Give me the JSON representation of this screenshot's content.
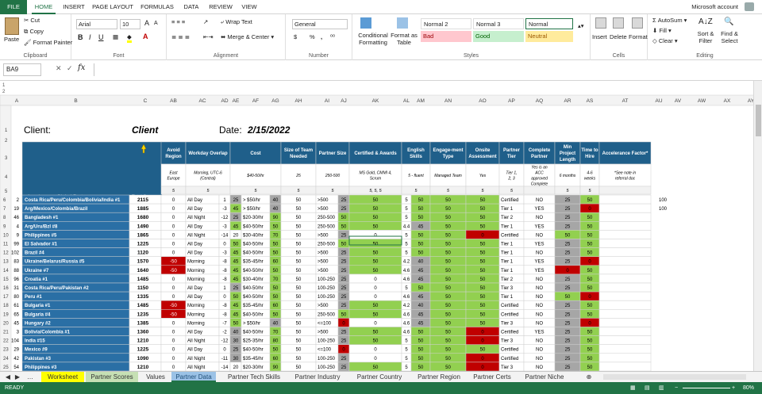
{
  "ribbon_tabs": [
    "FILE",
    "HOME",
    "INSERT",
    "PAGE LAYOUT",
    "FORMULAS",
    "DATA",
    "REVIEW",
    "VIEW"
  ],
  "account": "Microsoft account",
  "clipboard": {
    "paste": "Paste",
    "cut": "Cut",
    "copy": "Copy",
    "format_painter": "Format Painter",
    "label": "Clipboard"
  },
  "font": {
    "name": "Arial",
    "size": "10",
    "label": "Font",
    "grow": "A",
    "shrink": "A",
    "bold": "B",
    "italic": "I",
    "underline": "U"
  },
  "alignment": {
    "wrap": "Wrap Text",
    "merge": "Merge & Center",
    "label": "Alignment"
  },
  "number": {
    "format": "General",
    "currency": "$",
    "percent": "%",
    "comma": ",",
    "label": "Number"
  },
  "styles": {
    "conditional": "Conditional Formatting",
    "format_as_table": "Format as Table",
    "label": "Styles",
    "cells": [
      {
        "name": "Normal 2",
        "bg": "#ffffff",
        "fg": "#000000"
      },
      {
        "name": "Normal 3",
        "bg": "#ffffff",
        "fg": "#000000"
      },
      {
        "name": "Normal",
        "bg": "#ffffff",
        "fg": "#000000"
      },
      {
        "name": "Bad",
        "bg": "#ffc7ce",
        "fg": "#9c0006"
      },
      {
        "name": "Good",
        "bg": "#c6efce",
        "fg": "#006100"
      },
      {
        "name": "Neutral",
        "bg": "#ffeb9c",
        "fg": "#9c5700"
      }
    ]
  },
  "cells_group": {
    "insert": "Insert",
    "delete": "Delete",
    "format": "Format",
    "label": "Cells"
  },
  "editing": {
    "autosum": "AutoSum",
    "fill": "Fill",
    "clear": "Clear",
    "sort": "Sort & Filter",
    "find": "Find & Select",
    "label": "Editing"
  },
  "name_box": "BA9",
  "formula_fx": "fx",
  "columns": [
    "A",
    "B",
    "C",
    "AB",
    "AC",
    "AD",
    "AE",
    "AF",
    "AG",
    "AH",
    "AI",
    "AJ",
    "AK",
    "AL",
    "AM",
    "AN",
    "AO",
    "AP",
    "AQ",
    "AR",
    "AS",
    "AT",
    "AU",
    "AV",
    "AW",
    "AX",
    "AY"
  ],
  "client_label": "Client:",
  "client_value": "Client",
  "date_label": "Date:",
  "date_value": "2/15/2022",
  "headers": [
    "Avoid Region",
    "Workday Overlap",
    "Cost",
    "Size of Team Needed",
    "Partner Size",
    "Certified & Awards",
    "English Skills",
    "Engage-ment Type",
    "Onsite Assessment",
    "Partner Tier",
    "Complete Partner",
    "Min Project Length",
    "Time to Hire",
    "Accelerance Factor*"
  ],
  "criteria": [
    "East Europe",
    "Morning, UTC-6 (Central)",
    "$40-50/hr",
    "25",
    "250-500",
    "MS Gold, CMMI 4, Scrum",
    "5 - fluent",
    "Managed Team",
    "Yes",
    "Tier 1, 2, 3",
    "Yes is an ACC approved Complete Partner",
    "6 months",
    "4-6 weeks",
    "*See note in referral doc"
  ],
  "weights": [
    "5",
    "5",
    "5",
    "5",
    "5",
    "5, 5, 5",
    "5",
    "5",
    "5",
    "5",
    "",
    "5",
    "5",
    ""
  ],
  "label_partner": "Accelerance Global Partner",
  "label_total": "Total Score",
  "rows": [
    {
      "n": "6",
      "a": "2",
      "name": "Costa Rica/Peru/Colombia/Bolivia/India #1",
      "total": "2115",
      "ab": "0",
      "ac": "All Day",
      "ad": "1",
      "ae": "25",
      "af": "> $50/hr",
      "ag": "40",
      "ah": "50",
      "ai": ">500",
      "aj": "25",
      "ak": "50",
      "al": "5",
      "am": "50",
      "an": "50",
      "ao": "50",
      "ap": "Certified",
      "aq": "NO",
      "ar": "25",
      "as": "50",
      "au": "100"
    },
    {
      "n": "7",
      "a": "19",
      "name": "Arg/Mexico/Colombia/Brazil",
      "total": "1885",
      "ab": "0",
      "ac": "All Day",
      "ad": "-3",
      "ae": "45",
      "af": "> $50/hr",
      "ag": "40",
      "ah": "50",
      "ai": ">500",
      "aj": "25",
      "ak": "50",
      "al": "5",
      "am": "50",
      "an": "50",
      "ao": "50",
      "ap": "Tier 1",
      "aq": "YES",
      "ar": "25",
      "as": "0",
      "au": "100"
    },
    {
      "n": "8",
      "a": "46",
      "name": "Bangladesh #1",
      "total": "1680",
      "ab": "0",
      "ac": "All Night",
      "ad": "-12",
      "ae": "25",
      "af": "$20-30/hr",
      "ag": "90",
      "ah": "50",
      "ai": "250-500",
      "aj": "50",
      "ak": "50",
      "al": "5",
      "am": "50",
      "an": "50",
      "ao": "50",
      "ap": "Tier 2",
      "aq": "NO",
      "ar": "25",
      "as": "50",
      "au": ""
    },
    {
      "n": "9",
      "a": "4",
      "name": "Arg/Uru/Bzl #8",
      "total": "1490",
      "ab": "0",
      "ac": "All Day",
      "ad": "-3",
      "ae": "45",
      "af": "$40-50/hr",
      "ag": "50",
      "ah": "50",
      "ai": "250-500",
      "aj": "50",
      "ak": "50",
      "al": "4.4",
      "am": "45",
      "an": "50",
      "ao": "50",
      "ap": "Tier 1",
      "aq": "YES",
      "ar": "25",
      "as": "50",
      "au": ""
    },
    {
      "n": "10",
      "a": "9",
      "name": "Philippines #5",
      "total": "1865",
      "ab": "0",
      "ac": "All Night",
      "ad": "-14",
      "ae": "20",
      "af": "$30-40/hr",
      "ag": "70",
      "ah": "50",
      "ai": ">500",
      "aj": "25",
      "ak": "0",
      "al": "5",
      "am": "50",
      "an": "50",
      "ao": "0",
      "ap": "Certified",
      "aq": "NO",
      "ar": "50",
      "as": "50",
      "au": ""
    },
    {
      "n": "11",
      "a": "99",
      "name": "El Salvador #1",
      "total": "1225",
      "ab": "0",
      "ac": "All Day",
      "ad": "0",
      "ae": "50",
      "af": "$40-50/hr",
      "ag": "50",
      "ah": "50",
      "ai": "250-500",
      "aj": "50",
      "ak": "50",
      "al": "5",
      "am": "50",
      "an": "50",
      "ao": "50",
      "ap": "Tier 1",
      "aq": "YES",
      "ar": "25",
      "as": "50",
      "au": ""
    },
    {
      "n": "12",
      "a": "102",
      "name": "Brazil #4",
      "total": "1120",
      "ab": "0",
      "ac": "All Day",
      "ad": "-3",
      "ae": "45",
      "af": "$40-50/hr",
      "ag": "50",
      "ah": "50",
      "ai": ">500",
      "aj": "25",
      "ak": "50",
      "al": "5",
      "am": "50",
      "an": "50",
      "ao": "50",
      "ap": "Tier 1",
      "aq": "NO",
      "ar": "25",
      "as": "50",
      "au": ""
    },
    {
      "n": "13",
      "a": "83",
      "name": "Ukraine/Belarus/Russia #5",
      "total": "1570",
      "ab": "-50",
      "ac": "Morning",
      "ad": "-8",
      "ae": "45",
      "af": "$35-45/hr",
      "ag": "60",
      "ah": "50",
      "ai": ">500",
      "aj": "25",
      "ak": "50",
      "al": "4.2",
      "am": "40",
      "an": "50",
      "ao": "50",
      "ap": "Tier 1",
      "aq": "YES",
      "ar": "25",
      "as": "0",
      "au": ""
    },
    {
      "n": "14",
      "a": "88",
      "name": "Ukraine #7",
      "total": "1640",
      "ab": "-50",
      "ac": "Morning",
      "ad": "-8",
      "ae": "45",
      "af": "$40-50/hr",
      "ag": "50",
      "ah": "50",
      "ai": ">500",
      "aj": "25",
      "ak": "50",
      "al": "4.6",
      "am": "45",
      "an": "50",
      "ao": "50",
      "ap": "Tier 1",
      "aq": "YES",
      "ar": "0",
      "as": "50",
      "au": ""
    },
    {
      "n": "15",
      "a": "96",
      "name": "Croatia #1",
      "total": "1485",
      "ab": "0",
      "ac": "Morning",
      "ad": "-8",
      "ae": "45",
      "af": "$30-40/hr",
      "ag": "70",
      "ah": "50",
      "ai": "100-250",
      "aj": "25",
      "ak": "0",
      "al": "4.6",
      "am": "45",
      "an": "50",
      "ao": "50",
      "ap": "Tier 2",
      "aq": "NO",
      "ar": "25",
      "as": "50",
      "au": ""
    },
    {
      "n": "16",
      "a": "31",
      "name": "Costa Rica/Peru/Pakistan #2",
      "total": "1150",
      "ab": "0",
      "ac": "All Day",
      "ad": "1",
      "ae": "25",
      "af": "$40-50/hr",
      "ag": "50",
      "ah": "50",
      "ai": "100-250",
      "aj": "25",
      "ak": "0",
      "al": "5",
      "am": "50",
      "an": "50",
      "ao": "50",
      "ap": "Tier 3",
      "aq": "NO",
      "ar": "25",
      "as": "50",
      "au": ""
    },
    {
      "n": "17",
      "a": "80",
      "name": "Peru #1",
      "total": "1335",
      "ab": "0",
      "ac": "All Day",
      "ad": "0",
      "ae": "50",
      "af": "$40-50/hr",
      "ag": "50",
      "ah": "50",
      "ai": "100-250",
      "aj": "25",
      "ak": "0",
      "al": "4.6",
      "am": "45",
      "an": "50",
      "ao": "50",
      "ap": "Tier 1",
      "aq": "NO",
      "ar": "50",
      "as": "0",
      "au": ""
    },
    {
      "n": "18",
      "a": "61",
      "name": "Bulgaria #1",
      "total": "1485",
      "ab": "-50",
      "ac": "Morning",
      "ad": "-8",
      "ae": "45",
      "af": "$35-45/hr",
      "ag": "60",
      "ah": "50",
      "ai": ">500",
      "aj": "25",
      "ak": "50",
      "al": "4.2",
      "am": "40",
      "an": "50",
      "ao": "50",
      "ap": "Certified",
      "aq": "NO",
      "ar": "25",
      "as": "50",
      "au": ""
    },
    {
      "n": "19",
      "a": "65",
      "name": "Bulgaria #4",
      "total": "1235",
      "ab": "-50",
      "ac": "Morning",
      "ad": "-8",
      "ae": "45",
      "af": "$40-50/hr",
      "ag": "50",
      "ah": "50",
      "ai": "250-500",
      "aj": "50",
      "ak": "50",
      "al": "4.6",
      "am": "45",
      "an": "50",
      "ao": "50",
      "ap": "Certified",
      "aq": "NO",
      "ar": "25",
      "as": "50",
      "au": ""
    },
    {
      "n": "20",
      "a": "45",
      "name": "Hungary #2",
      "total": "1385",
      "ab": "0",
      "ac": "Morning",
      "ad": "-7",
      "ae": "50",
      "af": "> $50/hr",
      "ag": "40",
      "ah": "50",
      "ai": "<=100",
      "aj": "0",
      "ak": "0",
      "al": "4.6",
      "am": "45",
      "an": "50",
      "ao": "50",
      "ap": "Tier 3",
      "aq": "NO",
      "ar": "25",
      "as": "0",
      "au": ""
    },
    {
      "n": "21",
      "a": "3",
      "name": "Bolivia/Colombia #1",
      "total": "1360",
      "ab": "0",
      "ac": "All Day",
      "ad": "-2",
      "ae": "40",
      "af": "$40-50/hr",
      "ag": "70",
      "ah": "50",
      "ai": ">500",
      "aj": "25",
      "ak": "50",
      "al": "4.6",
      "am": "50",
      "an": "50",
      "ao": "0",
      "ap": "Certified",
      "aq": "YES",
      "ar": "25",
      "as": "50",
      "au": ""
    },
    {
      "n": "22",
      "a": "104",
      "name": "India #15",
      "total": "1210",
      "ab": "0",
      "ac": "All Night",
      "ad": "-12",
      "ae": "30",
      "af": "$25-35/hr",
      "ag": "80",
      "ah": "50",
      "ai": "100-250",
      "aj": "25",
      "ak": "50",
      "al": "5",
      "am": "50",
      "an": "50",
      "ao": "0",
      "ap": "Tier 3",
      "aq": "NO",
      "ar": "25",
      "as": "50",
      "au": ""
    },
    {
      "n": "23",
      "a": "29",
      "name": "Mexico #9",
      "total": "1225",
      "ab": "0",
      "ac": "All Day",
      "ad": "0",
      "ae": "25",
      "af": "$40-50/hr",
      "ag": "50",
      "ah": "50",
      "ai": "<=100",
      "aj": "0",
      "ak": "0",
      "al": "5",
      "am": "50",
      "an": "50",
      "ao": "50",
      "ap": "Certified",
      "aq": "NO",
      "ar": "25",
      "as": "50",
      "au": ""
    },
    {
      "n": "24",
      "a": "42",
      "name": "Pakistan #3",
      "total": "1090",
      "ab": "0",
      "ac": "All Night",
      "ad": "-11",
      "ae": "30",
      "af": "$35-45/hr",
      "ag": "60",
      "ah": "50",
      "ai": "100-250",
      "aj": "25",
      "ak": "0",
      "al": "5",
      "am": "50",
      "an": "50",
      "ao": "0",
      "ap": "Certified",
      "aq": "NO",
      "ar": "25",
      "as": "50",
      "au": ""
    },
    {
      "n": "25",
      "a": "54",
      "name": "Philippines #3",
      "total": "1210",
      "ab": "0",
      "ac": "All Night",
      "ad": "-14",
      "ae": "20",
      "af": "$20-30/hr",
      "ag": "90",
      "ah": "50",
      "ai": "100-250",
      "aj": "25",
      "ak": "50",
      "al": "5",
      "am": "50",
      "an": "50",
      "ao": "0",
      "ap": "Tier 3",
      "aq": "NO",
      "ar": "25",
      "as": "50",
      "au": ""
    }
  ],
  "sheet_tabs": [
    "Worksheet",
    "Partner Scores",
    "Values",
    "Partner Data",
    "Partner Tech Skills",
    "Partner Industry",
    "Partner Country",
    "Partner Region",
    "Partner Certs",
    "Partner Niche"
  ],
  "status_ready": "READY",
  "zoom": "80%",
  "colors": {
    "excel_green": "#217346",
    "header_blue": "#1f5f8a",
    "row_blue": "#2a6fa5",
    "good_green": "#92d050",
    "bad_red": "#c00000",
    "gray": "#a6a6a6"
  }
}
